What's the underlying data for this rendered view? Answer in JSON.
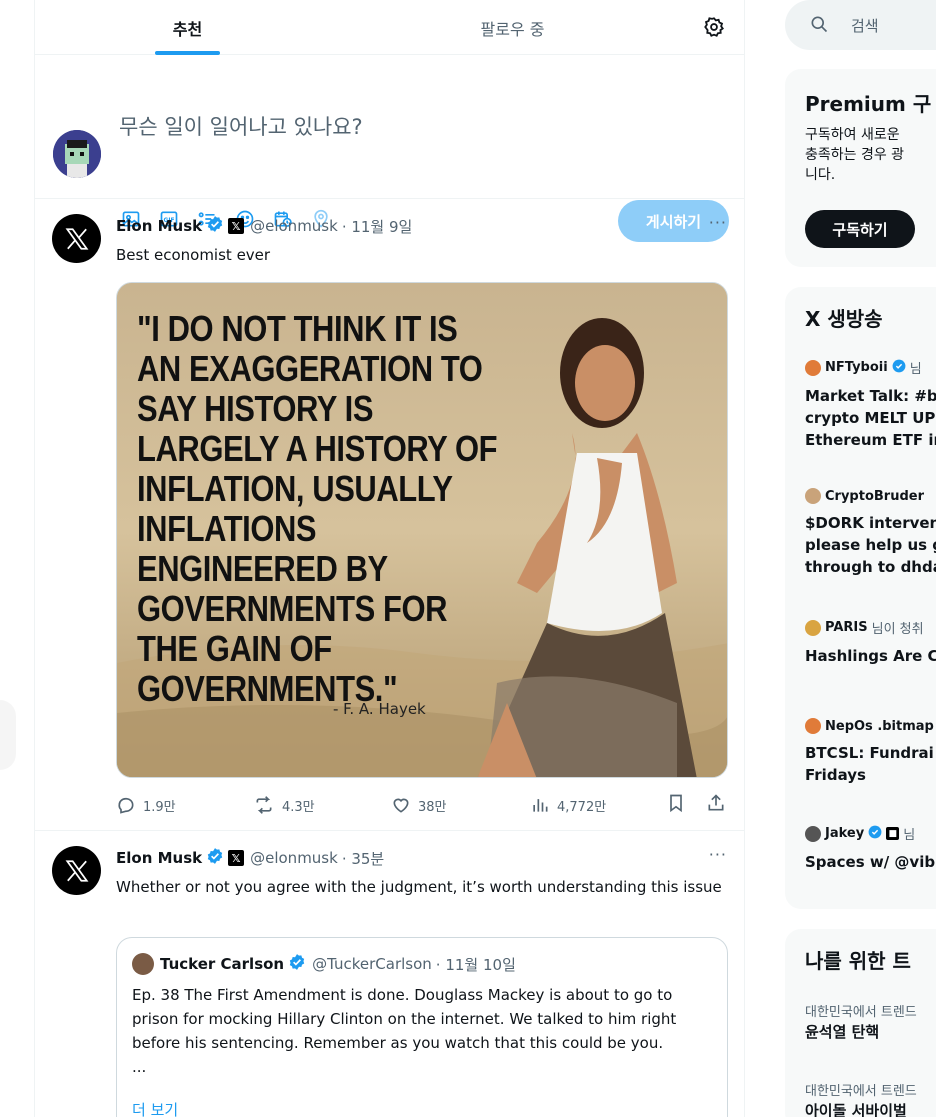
{
  "tabs": {
    "recommended": "추천",
    "following": "팔로우 중"
  },
  "composer": {
    "placeholder": "무슨 일이 일어나고 있나요?",
    "post_label": "게시하기"
  },
  "tweets": [
    {
      "name": "Elon Musk",
      "handle": "@elonmusk",
      "time": "· 11월 9일",
      "text": "Best economist ever",
      "image_quote": "\"I DO NOT THINK IT IS AN EXAGGERATION TO SAY HISTORY IS LARGELY A HISTORY OF INFLATION, USUALLY INFLATIONS ENGINEERED BY GOVERNMENTS FOR THE GAIN OF GOVERNMENTS.\"",
      "image_author": "- F. A. Hayek",
      "stats": {
        "replies": "1.9만",
        "reposts": "4.3만",
        "likes": "38만",
        "views": "4,772만"
      }
    },
    {
      "name": "Elon Musk",
      "handle": "@elonmusk",
      "time": "· 35분",
      "text": "Whether or not you agree with the judgment, it’s worth understanding this issue",
      "quote": {
        "name": "Tucker Carlson",
        "handle": "@TuckerCarlson",
        "time": "· 11월 10일",
        "text": "Ep. 38  The First Amendment is done. Douglass Mackey is about to go to prison for mocking Hillary Clinton on the internet. We talked to him right before his sentencing. Remember as you watch that this could be you.",
        "ellipsis": "...",
        "more": "더 보기"
      }
    }
  ],
  "sidebar": {
    "search_placeholder": "검색",
    "premium": {
      "title": "Premium 구",
      "body_lines": [
        "구독하여 새로운",
        "충족하는 경우 광",
        "니다."
      ],
      "button": "구독하기"
    },
    "live": {
      "title": "X 생방송",
      "items": [
        {
          "host": "NFTyboii",
          "extra": "님",
          "title_lines": [
            "Market Talk: #b",
            "crypto MELT UP",
            "Ethereum ETF ir"
          ]
        },
        {
          "host": "CryptoBruder",
          "extra": "",
          "title_lines": [
            "$DORK interven",
            "please help us g",
            "through to dhda"
          ]
        },
        {
          "host": "PARIS",
          "extra": "님이 청취",
          "title_lines": [
            "Hashlings Are C"
          ]
        },
        {
          "host": "NepOs .bitmap",
          "extra": "",
          "title_lines": [
            "BTCSL: Fundrai",
            "Fridays"
          ]
        },
        {
          "host": "Jakey",
          "extra": "님",
          "title_lines": [
            "Spaces w/ @vib"
          ]
        }
      ]
    },
    "trends": {
      "title": "나를 위한 트",
      "items": [
        {
          "context": "대한민국에서 트렌드",
          "name": "윤석열 탄핵"
        },
        {
          "context": "대한민국에서 트렌드",
          "name": "아이돌 서바이벌"
        }
      ]
    }
  },
  "colors": {
    "accent": "#1d9bf0",
    "post_button_disabled": "#8ecdf8",
    "muted": "#536471"
  }
}
